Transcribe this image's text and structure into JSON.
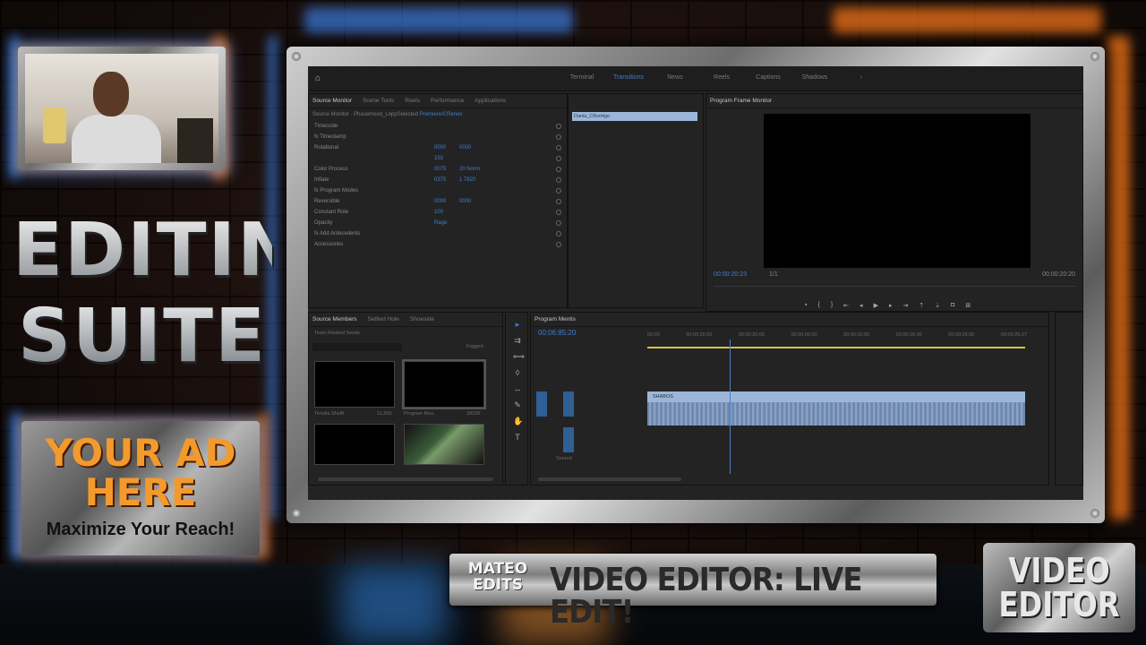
{
  "overlay": {
    "title_line1": "EDITING",
    "title_line2": "SUITE",
    "ad_line1": "YOUR AD",
    "ad_line2": "HERE",
    "ad_sub": "Maximize Your Reach!",
    "logo_line1": "MATEO",
    "logo_line2": "EDITS",
    "banner": "VIDEO EDITOR: LIVE EDIT!",
    "badge_line1": "VIDEO",
    "badge_line2": "EDITOR",
    "colors": {
      "fire": "#ff7a1a",
      "ice": "#3f8cff",
      "ad_text": "#f39a2d"
    }
  },
  "app": {
    "workspace_tabs": [
      "Terminal",
      "Transitions",
      "News",
      "Reels",
      "Captions",
      "Shadows"
    ],
    "active_workspace": "Transitions",
    "source_tabs": [
      "Source Monitor",
      "Scene Tools",
      "Reels",
      "Performance",
      "Applications"
    ],
    "ec_path": "Source Monitor · Phasemood_LoppSelected",
    "ec_path_hl": "Premiere/CRenex",
    "ec_rows": [
      {
        "label": "Timecode",
        "v": "",
        "v2": ""
      },
      {
        "label": "fx  Timestamp",
        "v": "",
        "v2": ""
      },
      {
        "label": "   Rotational",
        "v": "0000",
        "v2": "0000"
      },
      {
        "label": "",
        "v": "153",
        "v2": ""
      },
      {
        "label": "   Color Process",
        "v": "0075",
        "v2": "20 Norm"
      },
      {
        "label": "   Inflate",
        "v": "0375",
        "v2": "1 7820"
      },
      {
        "label": "fx  Program Modes",
        "v": "",
        "v2": ""
      },
      {
        "label": "   Reversible",
        "v": "0000",
        "v2": "0000"
      },
      {
        "label": "   Constant Role",
        "v": "100",
        "v2": ""
      },
      {
        "label": "   Opacity",
        "v": "Rage",
        "v2": ""
      },
      {
        "label": "fx  Add Antecedents",
        "v": "",
        "v2": ""
      },
      {
        "label": "Accessories",
        "v": "",
        "v2": ""
      }
    ],
    "ec_clip": "Dania_CBsmtgo",
    "pm_title": "Program Frame Monitor",
    "pm_tc_left": "00:00:20:23",
    "pm_tc_right": "00:00:20:20",
    "pm_fit": "1/1",
    "project_tabs": [
      "Source Members",
      "Settled Hole",
      "Shoeside"
    ],
    "project_item_label": "Team Related Seeds",
    "project_search_label": "Fogged",
    "thumbs": [
      {
        "label": "Tenella Shelft",
        "meta": "11,200"
      },
      {
        "label": "Program Mus..",
        "meta": "18236"
      },
      {
        "label": "",
        "meta": ""
      },
      {
        "label": "",
        "meta": ""
      }
    ],
    "timeline_title": "Program Mentis",
    "timeline_tc": "00:06:85:20",
    "ruler": [
      "00:00",
      "00:00:25:00",
      "00:00:20:00",
      "00:00:05:00",
      "00:00:10:00",
      "00:00:25:00",
      "00:00:25:00",
      "00:00:25:27"
    ],
    "video_clip": "SHABOS",
    "track_footer": "Soured"
  }
}
